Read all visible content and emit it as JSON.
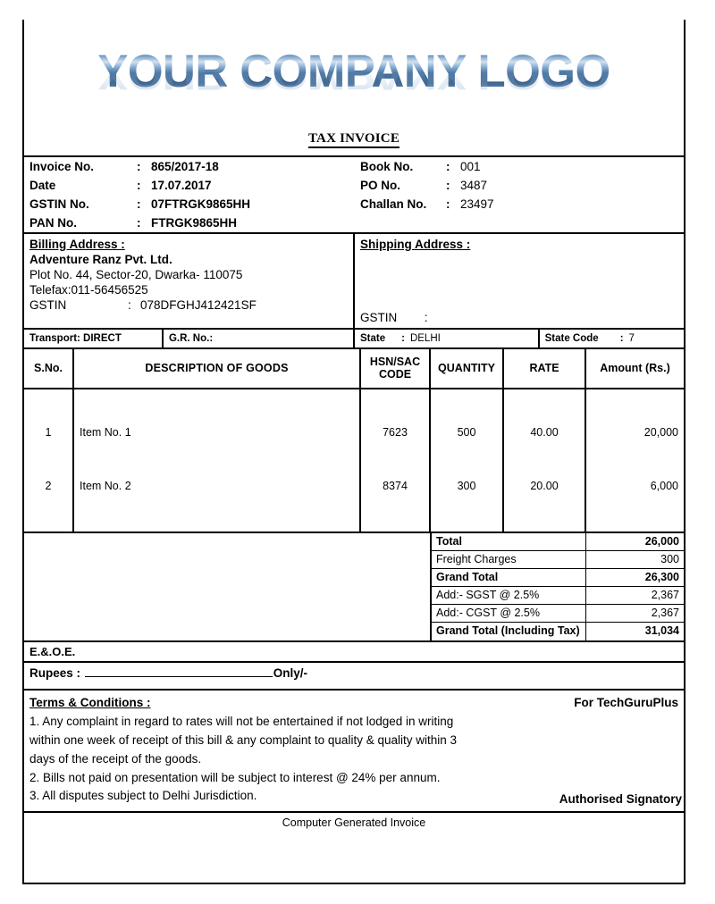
{
  "logo": {
    "text": "YOUR COMPANY LOGO",
    "accent_color": "#2c5c92"
  },
  "title": "TAX INVOICE",
  "header": {
    "left": [
      {
        "label": "Invoice No.",
        "colon": ":",
        "value": "865/2017-18"
      },
      {
        "label": "Date",
        "colon": ":",
        "value": "17.07.2017"
      },
      {
        "label": "GSTIN No.",
        "colon": ":",
        "value": "07FTRGK9865HH"
      },
      {
        "label": "PAN No.",
        "colon": ":",
        "value": "FTRGK9865HH"
      }
    ],
    "right": [
      {
        "label": "Book No.",
        "colon": ":",
        "value": "001"
      },
      {
        "label": "PO No.",
        "colon": ":",
        "value": "3487"
      },
      {
        "label": "Challan No.",
        "colon": ":",
        "value": "23497"
      },
      {
        "label": "",
        "colon": "",
        "value": ""
      }
    ]
  },
  "billing": {
    "heading": "Billing Address  :",
    "company": "Adventure Ranz Pvt. Ltd.",
    "address_line": "Plot No. 44, Sector-20, Dwarka- 110075",
    "telefax": "Telefax:011-56456525",
    "gstin_label": "GSTIN",
    "gstin_colon": ":",
    "gstin_value": "078DFGHJ412421SF"
  },
  "shipping": {
    "heading": "Shipping Address :",
    "gstin_label": "GSTIN",
    "gstin_colon": ":",
    "gstin_value": ""
  },
  "transport": {
    "transport": "Transport: DIRECT",
    "gr_no": "G.R. No.:",
    "state_label": "State",
    "state_colon": ":",
    "state_value": "DELHI",
    "state_code_label": "State Code",
    "state_code_colon": ":",
    "state_code_value": "7"
  },
  "items_table": {
    "columns": [
      "S.No.",
      "DESCRIPTION OF GOODS",
      "HSN/SAC CODE",
      "QUANTITY",
      "RATE",
      "Amount  (Rs.)"
    ],
    "col_hsn_line1": "HSN/SAC",
    "col_hsn_line2": "CODE",
    "rows": [
      {
        "sno": "1",
        "description": "Item No. 1",
        "hsn": "7623",
        "quantity": "500",
        "rate": "40.00",
        "amount": "20,000"
      },
      {
        "sno": "2",
        "description": "Item No. 2",
        "hsn": "8374",
        "quantity": "300",
        "rate": "20.00",
        "amount": "6,000"
      }
    ]
  },
  "totals": [
    {
      "label": "Total",
      "value": "26,000",
      "bold": true
    },
    {
      "label": "Freight Charges",
      "value": "300",
      "bold": false
    },
    {
      "label": "Grand Total",
      "value": "26,300",
      "bold": true
    },
    {
      "label": "Add:- SGST @ 2.5%",
      "value": "2,367",
      "bold": false
    },
    {
      "label": "Add:- CGST @ 2.5%",
      "value": "2,367",
      "bold": false
    },
    {
      "label": "Grand Total (Including Tax)",
      "value": "31,034",
      "bold": true
    }
  ],
  "eoe": "E.&.O.E.",
  "rupees": {
    "prefix": "Rupees :",
    "value": "",
    "suffix": "Only/-"
  },
  "terms": {
    "heading": "Terms & Conditions :",
    "lines": [
      "1. Any complaint in regard to rates will not be entertained if not lodged in writing",
      "within one week of receipt of this bill & any complaint to quality & quality within 3",
      "days of the receipt of the goods.",
      "2. Bills not paid on presentation will be subject to interest @ 24% per annum.",
      "3. All disputes subject to Delhi Jurisdiction."
    ]
  },
  "signature": {
    "for_company": "For TechGuruPlus",
    "authorised": "Authorised Signatory"
  },
  "footer": "Computer Generated Invoice"
}
